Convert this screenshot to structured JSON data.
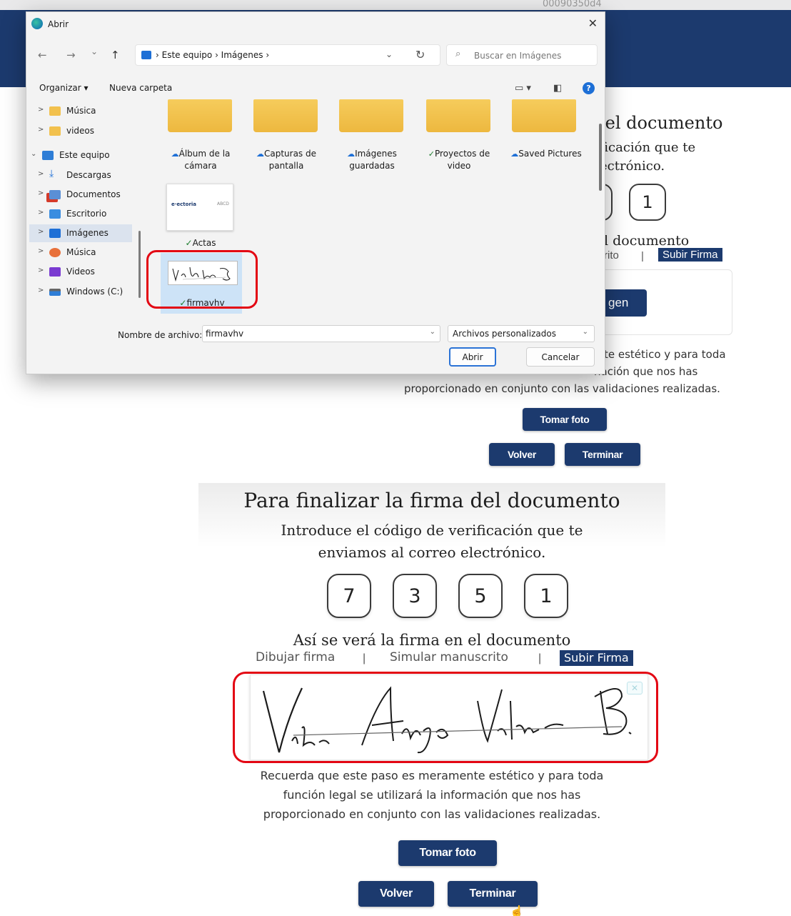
{
  "browser": {
    "url_fragment": "00090350d4"
  },
  "background_page": {
    "title_fragment": "lel documento",
    "subtitle_line1_fragment": "ficación que te",
    "subtitle_line2_fragment": "ectrónico.",
    "code_digits_visible": [
      "1"
    ],
    "preview_title_fragment": "l documento",
    "tab_fragment": "rito",
    "tab_separator": "|",
    "tab_upload": "Subir Firma",
    "image_button_fragment": "gen",
    "note_line1_fragment": "te estético y para toda",
    "note_line2_fragment": "nación que nos has",
    "note_line3": "proporcionado en conjunto con las validaciones realizadas.",
    "btn_photo": "Tomar foto",
    "btn_back": "Volver",
    "btn_finish": "Terminar"
  },
  "dialog": {
    "title": "Abrir",
    "close": "✕",
    "nav": {
      "back": "←",
      "forward": "→",
      "dropdown": "⌄",
      "up": "↑"
    },
    "breadcrumb": "›  Este equipo  ›  Imágenes  ›",
    "refresh": "↻",
    "search_placeholder": "Buscar en Imágenes",
    "toolbar": {
      "organize": "Organizar ▾",
      "new_folder": "Nueva carpeta",
      "help": "?"
    },
    "nav_items": [
      {
        "label": "Música",
        "chev": ">"
      },
      {
        "label": "videos",
        "chev": ">"
      },
      {
        "label": "Este equipo",
        "chev": "⌄"
      },
      {
        "label": "Descargas",
        "chev": ">"
      },
      {
        "label": "Documentos",
        "chev": ">"
      },
      {
        "label": "Escritorio",
        "chev": ">"
      },
      {
        "label": "Imágenes",
        "chev": ">"
      },
      {
        "label": "Música",
        "chev": ">"
      },
      {
        "label": "Videos",
        "chev": ">"
      },
      {
        "label": "Windows (C:)",
        "chev": ">"
      }
    ],
    "folders": [
      {
        "line1": "Álbum de la",
        "line2": "cámara",
        "status": "☁"
      },
      {
        "line1": "Capturas de",
        "line2": "pantalla",
        "status": "☁"
      },
      {
        "line1": "Imágenes",
        "line2": "guardadas",
        "status": "☁"
      },
      {
        "line1": "Proyectos de",
        "line2": "video",
        "status": "✓"
      },
      {
        "line1": "Saved Pictures",
        "line2": "",
        "status": "☁"
      }
    ],
    "files": [
      {
        "name": "Actas",
        "status": "✓",
        "thumb_text": "e·ectoria",
        "thumb_text2": "ABCD"
      },
      {
        "name": "firmavhv",
        "status": "✓"
      }
    ],
    "filename_label": "Nombre de archivo:",
    "filename_value": "firmavhv",
    "filetype_value": "Archivos personalizados",
    "btn_open": "Abrir",
    "btn_cancel": "Cancelar"
  },
  "page": {
    "title": "Para finalizar la firma del documento",
    "subtitle_line1": "Introduce el código de verificación que te",
    "subtitle_line2": "enviamos al correo electrónico.",
    "code_digits": [
      "7",
      "3",
      "5",
      "1"
    ],
    "preview_title": "Así se verá la firma en el documento",
    "tabs": [
      "Dibujar firma",
      "Simular manuscrito",
      "Subir Firma"
    ],
    "tab_separator": "|",
    "clear_icon": "✕",
    "note_line1": "Recuerda que este paso es meramente estético y para toda",
    "note_line2": "función legal se utilizará la información que nos has",
    "note_line3": "proporcionado en conjunto con las validaciones realizadas.",
    "btn_photo": "Tomar foto",
    "btn_back": "Volver",
    "btn_finish": "Terminar"
  },
  "colors": {
    "navy": "#1c3a6e",
    "highlight_red": "#e30613",
    "selection_blue": "#cde3f7",
    "folder_yellow": "#f2c14e"
  }
}
